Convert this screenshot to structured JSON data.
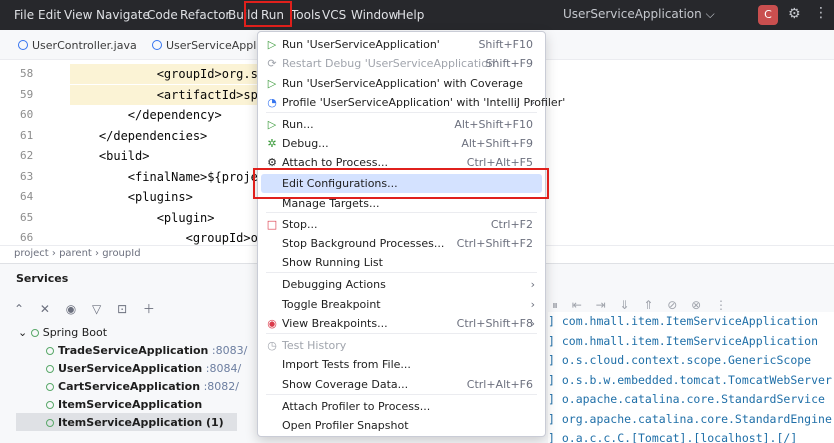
{
  "menubar": {
    "items": [
      "File",
      "Edit",
      "View",
      "Navigate",
      "Code",
      "Refactor",
      "Build",
      "Run",
      "Tools",
      "VCS",
      "Window",
      "Help"
    ],
    "run_config": "UserServiceApplication ⌵",
    "avatar": "C"
  },
  "tabs": [
    "UserController.java",
    "UserServiceApplicat"
  ],
  "editor": {
    "lines": [
      {
        "n": "58",
        "text": "            <groupId>org.spri"
      },
      {
        "n": "59",
        "text": "            <artifactId>sprin"
      },
      {
        "n": "60",
        "text": "        </dependency>"
      },
      {
        "n": "61",
        "text": "    </dependencies>"
      },
      {
        "n": "62",
        "text": "    <build>"
      },
      {
        "n": "63",
        "text": "        <finalName>${project."
      },
      {
        "n": "64",
        "text": "        <plugins>"
      },
      {
        "n": "65",
        "text": "            <plugin>"
      },
      {
        "n": "66",
        "text": "                <groupId>org."
      }
    ]
  },
  "breadcrumb": "project  ›  parent  ›  groupId",
  "services": {
    "title": "Services",
    "root": "Spring Boot",
    "apps": [
      {
        "name": "TradeServiceApplication",
        "port": ":8083/"
      },
      {
        "name": "UserServiceApplication",
        "port": ":8084/"
      },
      {
        "name": "CartServiceApplication",
        "port": ":8082/"
      },
      {
        "name": "ItemServiceApplication",
        "port": ""
      },
      {
        "name": "ItemServiceApplication (1)",
        "port": ""
      }
    ]
  },
  "console": [
    "] com.hmall.item.ItemServiceApplication",
    "] com.hmall.item.ItemServiceApplication",
    "] o.s.cloud.context.scope.GenericScope",
    "] o.s.b.w.embedded.tomcat.TomcatWebServer",
    "] o.apache.catalina.core.StandardService",
    "] org.apache.catalina.core.StandardEngine",
    "] o.a.c.c.C.[Tomcat].[localhost].[/]"
  ],
  "run_menu": {
    "items": [
      {
        "label": "Run 'UserServiceApplication'",
        "shortcut": "Shift+F10"
      },
      {
        "label": "Restart Debug 'UserServiceApplication'",
        "shortcut": "Shift+F9"
      },
      {
        "label": "Run 'UserServiceApplication' with Coverage",
        "shortcut": ""
      },
      {
        "label": "Profile 'UserServiceApplication' with 'IntelliJ Profiler'",
        "shortcut": ""
      },
      {
        "label": "Run...",
        "shortcut": "Alt+Shift+F10"
      },
      {
        "label": "Debug...",
        "shortcut": "Alt+Shift+F9"
      },
      {
        "label": "Attach to Process...",
        "shortcut": "Ctrl+Alt+F5"
      },
      {
        "label": "Edit Configurations...",
        "shortcut": ""
      },
      {
        "label": "Manage Targets...",
        "shortcut": ""
      },
      {
        "label": "Stop...",
        "shortcut": "Ctrl+F2"
      },
      {
        "label": "Stop Background Processes...",
        "shortcut": "Ctrl+Shift+F2"
      },
      {
        "label": "Show Running List",
        "shortcut": ""
      },
      {
        "label": "Debugging Actions",
        "shortcut": ""
      },
      {
        "label": "Toggle Breakpoint",
        "shortcut": ""
      },
      {
        "label": "View Breakpoints...",
        "shortcut": "Ctrl+Shift+F8"
      },
      {
        "label": "Test History",
        "shortcut": ""
      },
      {
        "label": "Import Tests from File...",
        "shortcut": ""
      },
      {
        "label": "Show Coverage Data...",
        "shortcut": "Ctrl+Alt+F6"
      },
      {
        "label": "Attach Profiler to Process...",
        "shortcut": ""
      },
      {
        "label": "Open Profiler Snapshot",
        "shortcut": ""
      }
    ]
  }
}
